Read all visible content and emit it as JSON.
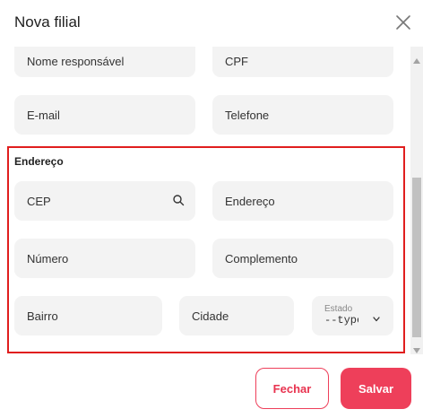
{
  "dialog": {
    "title": "Nova filial"
  },
  "fields": {
    "nome_responsavel": "Nome responsável",
    "cpf": "CPF",
    "email": "E-mail",
    "telefone": "Telefone"
  },
  "address": {
    "section_title": "Endereço",
    "cep": "CEP",
    "endereco": "Endereço",
    "numero": "Número",
    "complemento": "Complemento",
    "bairro": "Bairro",
    "cidade": "Cidade",
    "estado_label": "Estado",
    "estado_value": "--type"
  },
  "footer": {
    "close_label": "Fechar",
    "save_label": "Salvar"
  },
  "icons": {
    "close": "close-icon",
    "search": "search-icon",
    "chevron": "chevron-down-icon"
  },
  "colors": {
    "accent": "#ee3f5a",
    "highlight": "#e01e1e"
  }
}
